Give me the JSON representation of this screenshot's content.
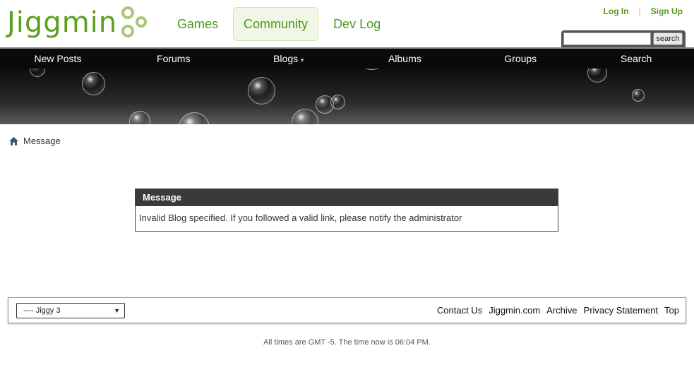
{
  "header": {
    "logo_text": "Jiggmin",
    "nav": [
      "Games",
      "Community",
      "Dev Log"
    ],
    "auth": {
      "login": "Log In",
      "separator": "|",
      "signup": "Sign Up"
    },
    "search": {
      "placeholder": "",
      "button": "search"
    }
  },
  "navbar": {
    "items": [
      "New Posts",
      "Forums",
      "Blogs",
      "Albums",
      "Groups",
      "Search"
    ],
    "blogs_caret": "▼"
  },
  "breadcrumb": {
    "current": "Message"
  },
  "message": {
    "title": "Message",
    "body": "Invalid Blog specified. If you followed a valid link, please notify the administrator"
  },
  "footer": {
    "style_selected": "---- Jiggy 3",
    "select_arrow": "▼",
    "links": [
      "Contact Us",
      "Jiggmin.com",
      "Archive",
      "Privacy Statement",
      "Top"
    ],
    "note": "All times are GMT -5. The time now is 06:04 PM."
  },
  "colors": {
    "brand_green": "#5aa020",
    "nav_bg": "#0a0a0a",
    "message_header": "#3a3a3a"
  },
  "icons": {
    "home": "home-icon",
    "caret": "caret-down-icon"
  }
}
